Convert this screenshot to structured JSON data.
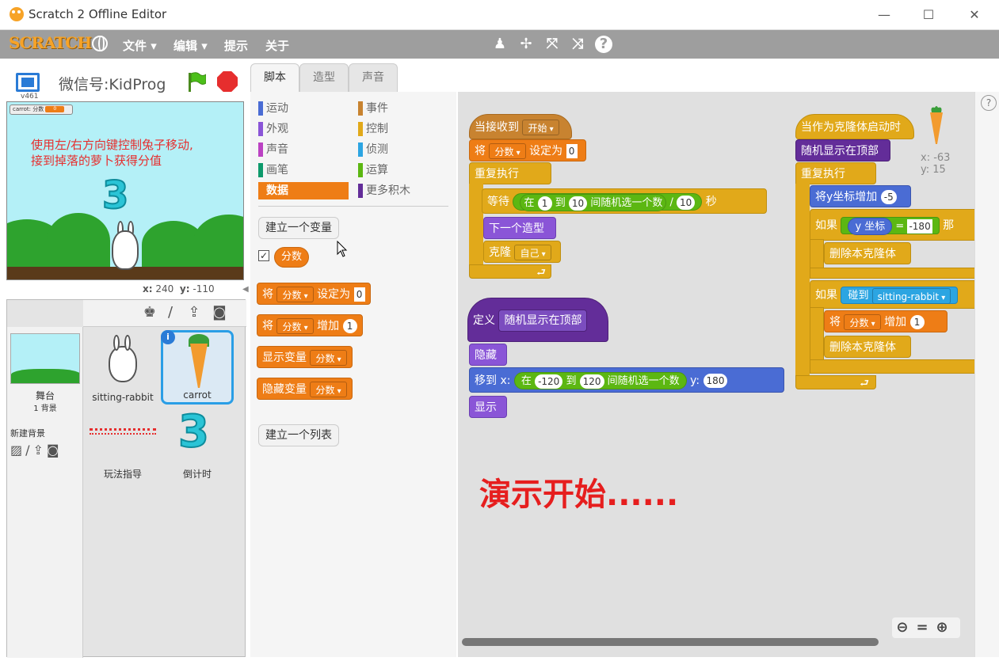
{
  "window": {
    "title": "Scratch 2 Offline Editor",
    "minimize": "—",
    "maximize": "☐",
    "close": "✕"
  },
  "menubar": {
    "logo": "SCRATCH",
    "file": "文件 ▾",
    "edit": "编辑 ▾",
    "tips": "提示",
    "about": "关于",
    "tools": [
      "stamp-icon",
      "grow-icon",
      "expand-icon",
      "shrink-icon",
      "help-icon"
    ],
    "tool_glyphs": [
      "♟",
      "✢",
      "⤧",
      "⤨",
      "?"
    ]
  },
  "stage_header": {
    "version": "v461",
    "project_name": "微信号:KidProg"
  },
  "stage": {
    "monitor_label": "carrot: 分数",
    "monitor_value": "0",
    "hint_line1": "使用左/右方向键控制兔子移动,",
    "hint_line2": "接到掉落的萝卜获得分值",
    "countdown": "3",
    "coords_x_label": "x:",
    "coords_x": "240",
    "coords_y_label": "y:",
    "coords_y": "-110"
  },
  "sprites_pane": {
    "stage_label": "舞台",
    "stage_sub": "1 背景",
    "new_backdrop": "新建背景",
    "sprites": [
      {
        "name": "sitting-rabbit"
      },
      {
        "name": "carrot",
        "selected": true
      },
      {
        "name": "玩法指导"
      },
      {
        "name": "倒计时"
      }
    ]
  },
  "tabs": [
    "脚本",
    "造型",
    "声音"
  ],
  "categories": [
    {
      "label": "运动",
      "color": "#4a6cd4"
    },
    {
      "label": "事件",
      "color": "#c88330"
    },
    {
      "label": "外观",
      "color": "#8a55d7"
    },
    {
      "label": "控制",
      "color": "#e1a91a"
    },
    {
      "label": "声音",
      "color": "#bb42c3"
    },
    {
      "label": "侦测",
      "color": "#2ca5e2"
    },
    {
      "label": "画笔",
      "color": "#0e9a6c"
    },
    {
      "label": "运算",
      "color": "#5cb712"
    },
    {
      "label": "数据",
      "color": "#ee7d16",
      "active": true
    },
    {
      "label": "更多积木",
      "color": "#632d99"
    }
  ],
  "palette": {
    "make_variable": "建立一个变量",
    "variable": "分数",
    "set_block": {
      "pre": "将",
      "var": "分数",
      "mid": "设定为",
      "val": "0"
    },
    "change_block": {
      "pre": "将",
      "var": "分数",
      "mid": "增加",
      "val": "1"
    },
    "show_var": {
      "pre": "显示变量",
      "var": "分数"
    },
    "hide_var": {
      "pre": "隐藏变量",
      "var": "分数"
    },
    "make_list": "建立一个列表"
  },
  "script1": {
    "hat": "当接收到",
    "hat_msg": "开始",
    "set_pre": "将",
    "set_var": "分数",
    "set_mid": "设定为",
    "set_val": "0",
    "forever": "重复执行",
    "wait": "等待",
    "rand_in": "在",
    "rand_a": "1",
    "rand_to": "到",
    "rand_b": "10",
    "rand_tail": "间随机选一个数",
    "div": "/",
    "div_val": "10",
    "wait_unit": "秒",
    "next_costume": "下一个造型",
    "clone": "克隆",
    "clone_target": "自己"
  },
  "script2": {
    "define": "定义",
    "proc": "随机显示在顶部",
    "hide": "隐藏",
    "goto": "移到 x:",
    "rand_in": "在",
    "rand_a": "-120",
    "rand_to": "到",
    "rand_b": "120",
    "rand_tail": "间随机选一个数",
    "y_label": "y:",
    "y_val": "180",
    "show": "显示"
  },
  "script3": {
    "hat": "当作为克隆体启动时",
    "call": "随机显示在顶部",
    "forever": "重复执行",
    "change_y": "将y坐标增加",
    "change_y_val": "-5",
    "if1": "如果",
    "y_pos": "y 坐标",
    "eq": "=",
    "eq_val": "-180",
    "then": "那",
    "delete1": "删除本克隆体",
    "if2": "如果",
    "touching": "碰到",
    "touch_target": "sitting-rabbit",
    "change_pre": "将",
    "change_var": "分数",
    "change_mid": "增加",
    "change_val": "1",
    "delete2": "删除本克隆体"
  },
  "sprite_info": {
    "x": "x: -63",
    "y": "y: 15"
  },
  "overlay_text": "演示开始......",
  "zoom": {
    "out": "🔍",
    "reset": "=",
    "in": "🔍"
  },
  "help": "?"
}
